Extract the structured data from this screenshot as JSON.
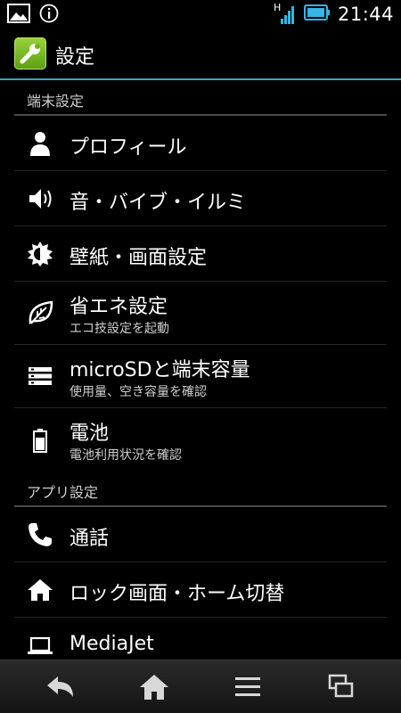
{
  "status_bar": {
    "time": "21:44",
    "network_label": "H",
    "icons": [
      "picture-icon",
      "info-icon",
      "signal-icon",
      "battery-icon"
    ]
  },
  "action_bar": {
    "title": "設定",
    "icon": "wrench-icon",
    "accent_color": "#33a3c4"
  },
  "sections": [
    {
      "label": "端末設定",
      "items": [
        {
          "title": "プロフィール",
          "icon": "person-icon"
        },
        {
          "title": "音・バイブ・イルミ",
          "icon": "speaker-icon"
        },
        {
          "title": "壁紙・画面設定",
          "icon": "brightness-icon"
        },
        {
          "title": "省エネ設定",
          "subtitle": "エコ技設定を起動",
          "icon": "leaf-icon"
        },
        {
          "title": "microSDと端末容量",
          "subtitle": "使用量、空き容量を確認",
          "icon": "storage-icon"
        },
        {
          "title": "電池",
          "subtitle": "電池利用状況を確認",
          "icon": "battery-icon"
        }
      ]
    },
    {
      "label": "アプリ設定",
      "items": [
        {
          "title": "通話",
          "icon": "phone-icon"
        },
        {
          "title": "ロック画面・ホーム切替",
          "icon": "home-icon"
        },
        {
          "title": "MediaJet",
          "icon": "laptop-icon"
        }
      ]
    }
  ],
  "nav_bar": {
    "buttons": [
      "back-icon",
      "home-icon",
      "menu-icon",
      "recent-apps-icon"
    ]
  }
}
